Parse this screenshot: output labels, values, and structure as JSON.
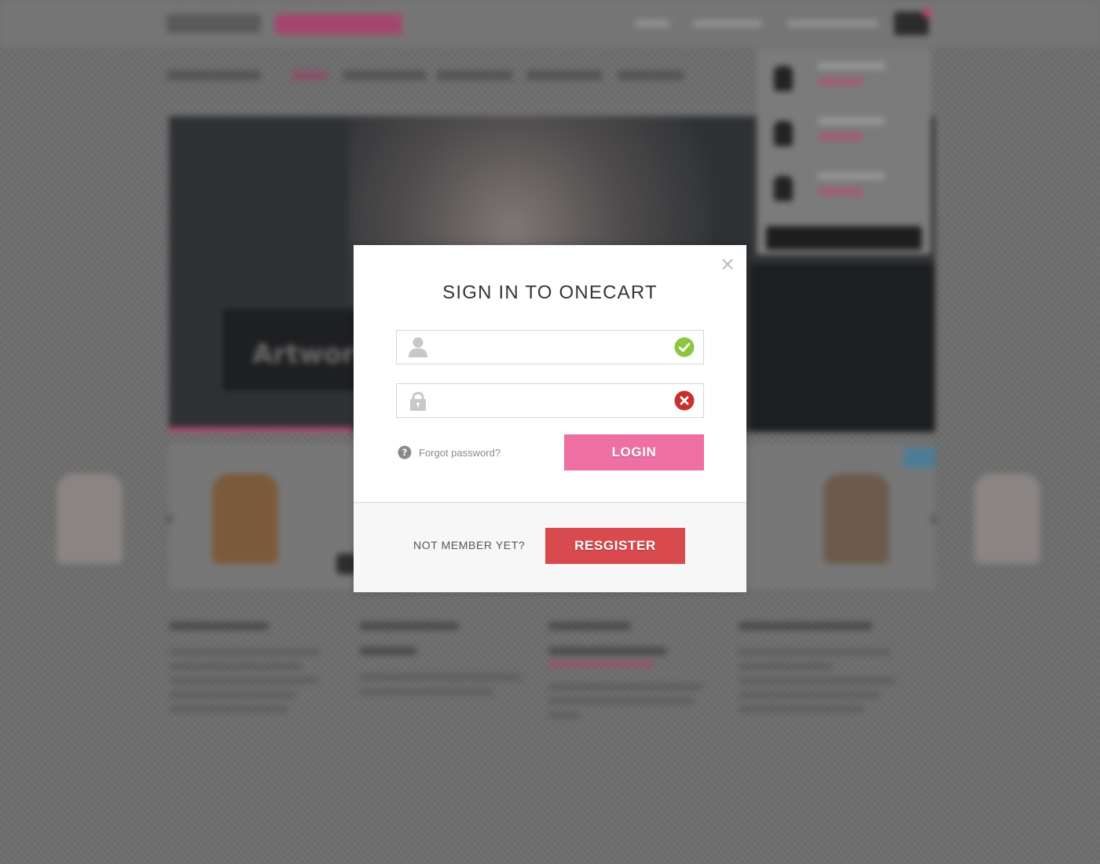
{
  "login_modal": {
    "title": "SIGN IN TO ONECART",
    "username": {
      "value": "",
      "placeholder": "",
      "icon": "user-icon",
      "status": "valid",
      "status_icon": "check-icon"
    },
    "password": {
      "value": "",
      "placeholder": "",
      "icon": "lock-icon",
      "status": "invalid",
      "status_icon": "error-icon"
    },
    "forgot_label": "Forgot password?",
    "login_label": "LOGIN",
    "not_member_label": "NOT MEMBER YET?",
    "register_label": "RESGISTER",
    "close_icon": "close-icon"
  },
  "colors": {
    "login_button": "#ee6fa1",
    "register_button": "#d84a4d",
    "valid": "#8cc63f",
    "invalid": "#c8302f",
    "overlay": "#6e6e6e"
  },
  "background": {
    "hero_caption": "Artwork"
  }
}
